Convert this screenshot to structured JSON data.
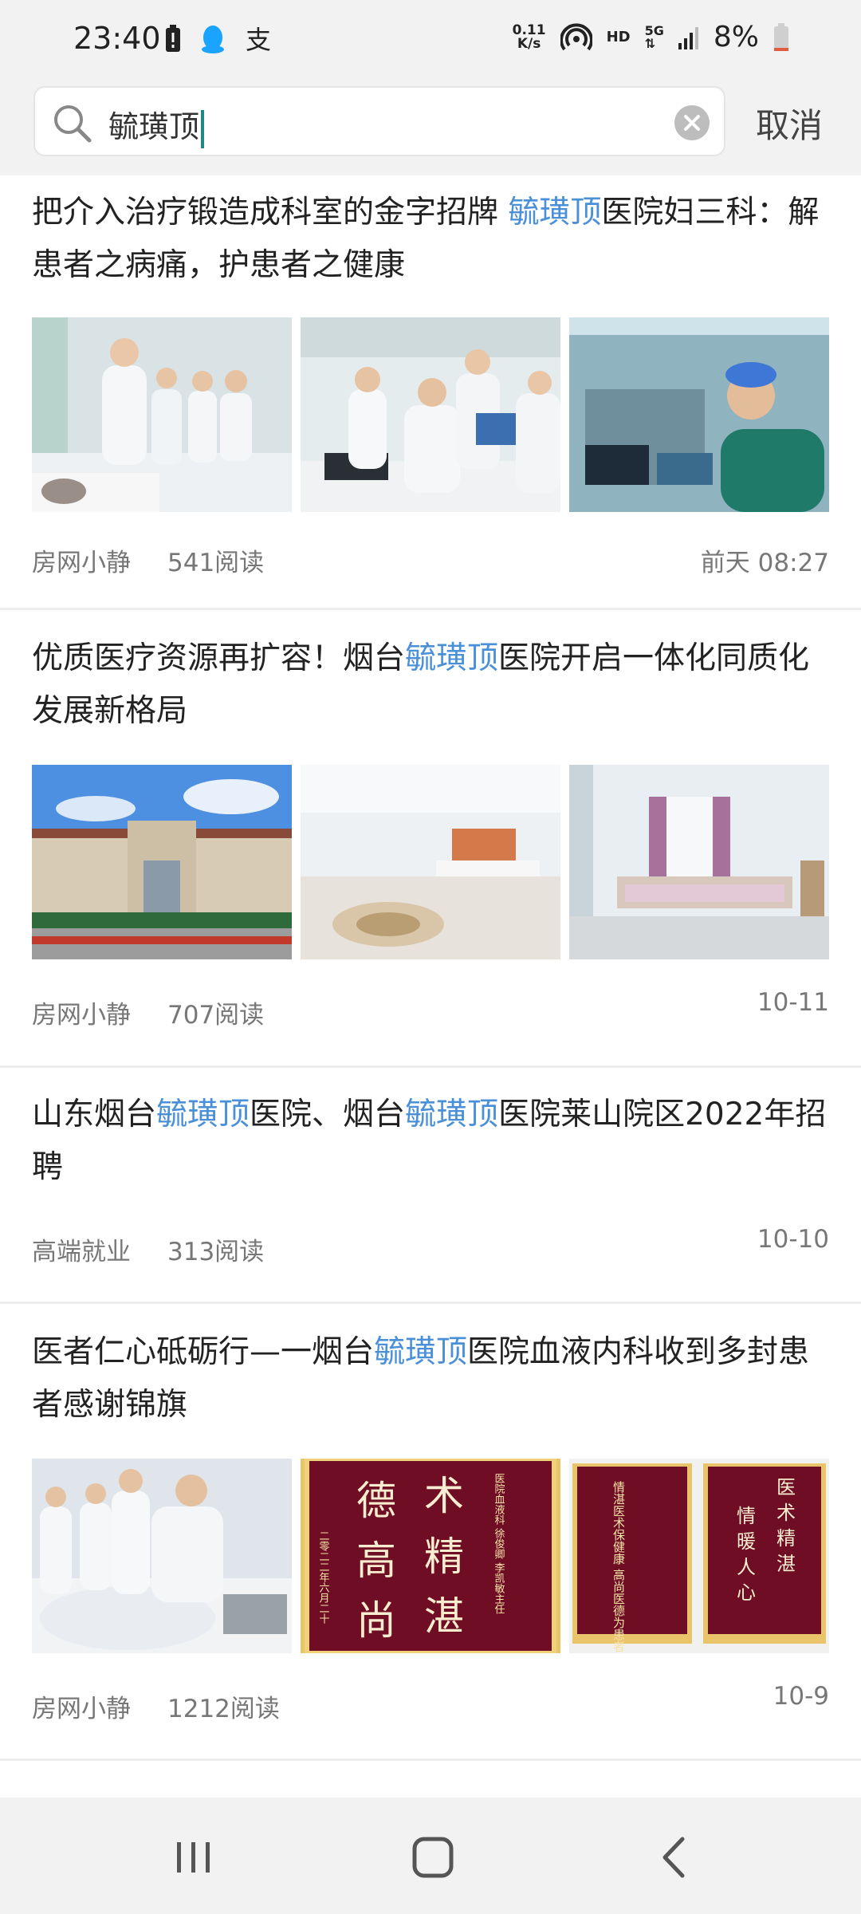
{
  "status_bar": {
    "time": "23:40",
    "net_speed_value": "0.11",
    "net_speed_unit": "K/s",
    "hd": "HD",
    "network": "5G",
    "battery": "8%",
    "icons": [
      "battery-saver-icon",
      "qq-icon",
      "alipay-icon",
      "hotspot-icon",
      "signal-icon",
      "battery-icon"
    ]
  },
  "search": {
    "query": "毓璜顶",
    "cancel_label": "取消"
  },
  "articles": [
    {
      "title_parts": [
        "把介入治疗锻造成科室的金字招牌 ",
        "毓璜顶",
        "医院妇三科：解患者之病痛，护患者之健康"
      ],
      "thumbs": [
        "doctors-ward-round-photo",
        "doctors-at-computer-photo",
        "surgeon-portrait-photo"
      ],
      "source": "房网小静",
      "reads": "541阅读",
      "time": "前天 08:27"
    },
    {
      "title_parts": [
        "优质医疗资源再扩容！烟台",
        "毓璜顶",
        "医院开启一体化同质化发展新格局"
      ],
      "thumbs": [
        "hospital-building-photo",
        "hospital-lobby-photo",
        "hospital-ward-photo"
      ],
      "source": "房网小静",
      "reads": "707阅读",
      "time": "10-11"
    },
    {
      "title_parts": [
        "山东烟台",
        "毓璜顶",
        "医院、烟台",
        "毓璜顶",
        "医院莱山院区2022年招聘"
      ],
      "thumbs": [],
      "source": "高端就业",
      "reads": "313阅读",
      "time": "10-10"
    },
    {
      "title_parts": [
        "医者仁心砥砺行—一烟台",
        "毓璜顶",
        "医院血液内科收到多封患者感谢锦旗"
      ],
      "thumbs": [
        "doctors-treating-patient-photo",
        "silk-banner-photo",
        "two-banners-photo"
      ],
      "banner_text": {
        "big": [
          "德",
          "术",
          "高",
          "精",
          "尚",
          "湛"
        ],
        "side": "医院血液科 徐俊卿 李凯敏主任",
        "date": "二零二二年六月二十"
      },
      "banner_pair_text": {
        "left": "情湛医术保健康 高尚医德为患者",
        "right_big": [
          "医",
          "术",
          "精",
          "湛",
          "情",
          "暖",
          "人",
          "心"
        ]
      },
      "source": "房网小静",
      "reads": "1212阅读",
      "time": "10-9"
    }
  ],
  "nav": {
    "buttons": [
      "recent-apps-icon",
      "home-icon",
      "back-icon"
    ]
  },
  "colors": {
    "highlight": "#4a90d9",
    "background_bar": "#f2f2f2",
    "banner_red": "#6e0d24",
    "banner_gold": "#e9c46a"
  }
}
